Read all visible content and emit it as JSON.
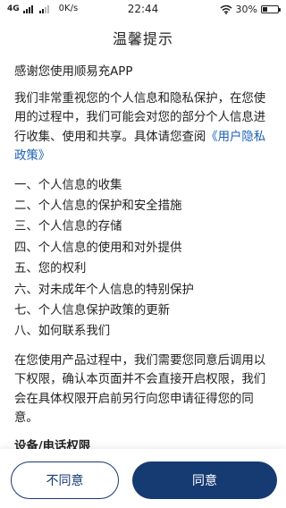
{
  "status_bar": {
    "network": "4G",
    "speed": "0K/s",
    "time": "22:44",
    "battery": "30%",
    "battery_level": 0.3
  },
  "dialog": {
    "title": "温馨提示",
    "greeting": "感谢您使用顺易充APP",
    "intro_text": "我们非常重视您的个人信息和隐私保护，在您使用的过程中，我们可能会对您的部分个人信息进行收集、使用和共享。具体请您查阅",
    "policy_link": "《用户隐私政策》",
    "toc": [
      "一、个人信息的收集",
      "二、个人信息的保护和安全措施",
      "三、个人信息的存储",
      "四、个人信息的使用和对外提供",
      "五、您的权利",
      "六、对未成年个人信息的特别保护",
      "七、个人信息保护政策的更新",
      "八、如何联系我们"
    ],
    "permission_note": "在您使用产品过程中，我们需要您同意后调用以下权限，确认本页面并不会直接开启权限，我们会在具体权限开启前另行向您申请征得您的同意。",
    "section_heading": "设备/电话权限"
  },
  "buttons": {
    "disagree": "不同意",
    "agree": "同意"
  },
  "colors": {
    "accent": "#163a72",
    "link": "#1a5fb4"
  }
}
